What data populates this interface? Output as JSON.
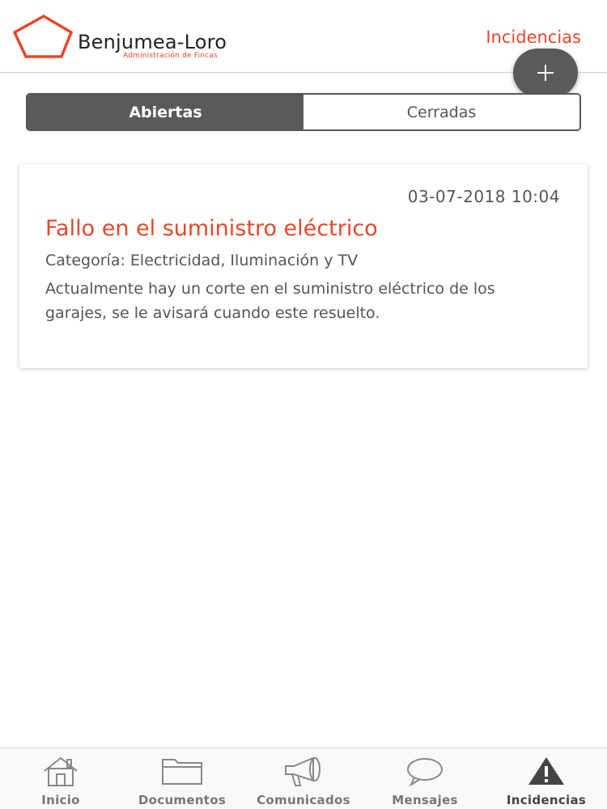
{
  "header": {
    "logo": {
      "name": "Benjumea-Loro",
      "tagline": "Administración de Fincas",
      "icon": "house-pentagon-icon"
    },
    "title": "Incidencias"
  },
  "add_button": {
    "icon": "plus-icon"
  },
  "segment": {
    "options": [
      {
        "label": "Abiertas",
        "selected": true
      },
      {
        "label": "Cerradas",
        "selected": false
      }
    ]
  },
  "incidents": [
    {
      "date": "03-07-2018 10:04",
      "title": "Fallo en el suministro eléctrico",
      "category": "Categoría: Electricidad, Iluminación y TV",
      "description": "Actualmente hay un corte en el suministro eléctrico de los garajes, se le avisará cuando este resuelto."
    }
  ],
  "tabbar": {
    "items": [
      {
        "label": "Inicio",
        "icon": "home-icon",
        "active": false
      },
      {
        "label": "Documentos",
        "icon": "folder-icon",
        "active": false
      },
      {
        "label": "Comunicados",
        "icon": "megaphone-icon",
        "active": false
      },
      {
        "label": "Mensajes",
        "icon": "chat-bubble-icon",
        "active": false
      },
      {
        "label": "Incidencias",
        "icon": "warning-icon",
        "active": true
      }
    ]
  },
  "colors": {
    "accent": "#e8472a",
    "dark": "#5a5a5a",
    "text": "#555555"
  }
}
